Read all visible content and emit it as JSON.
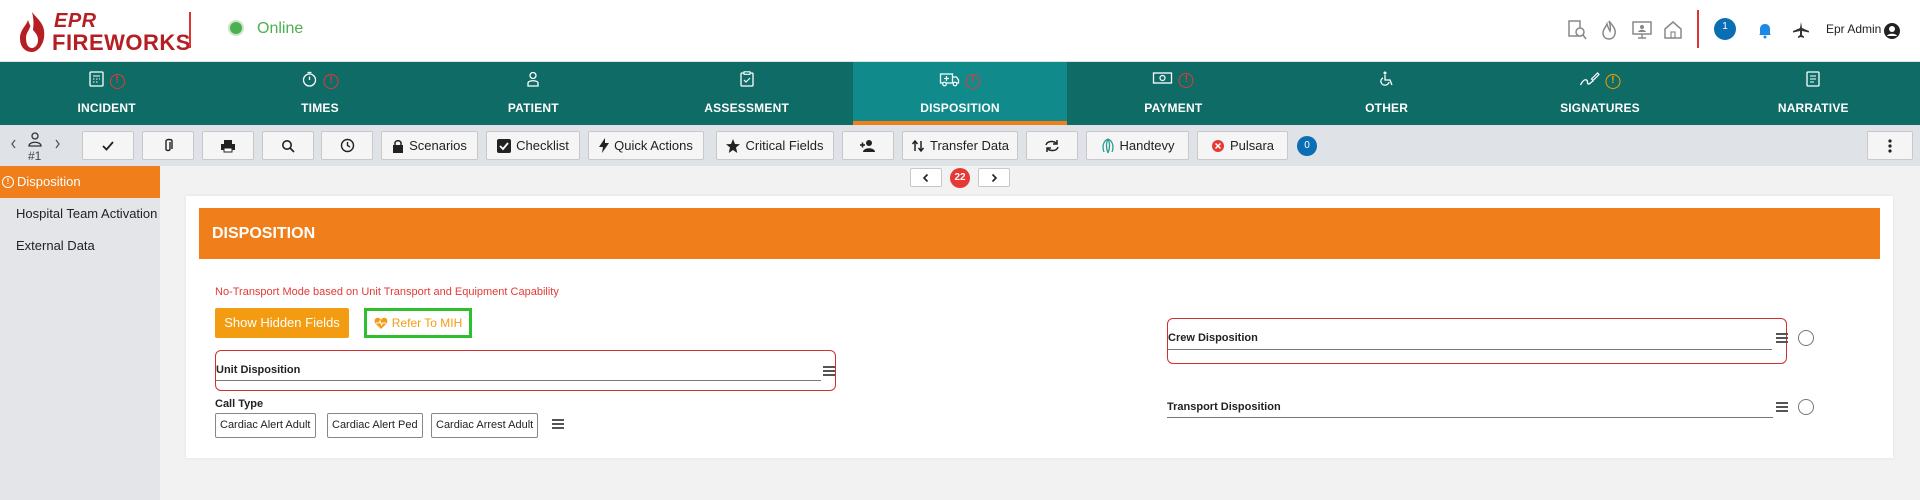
{
  "header": {
    "logo_top": "EPR",
    "logo_bottom": "FIREWORKS",
    "status": "Online",
    "chat_count": "1",
    "user_name": "Epr Admin"
  },
  "nav": {
    "tabs": [
      {
        "label": "INCIDENT",
        "icon": "calculator-icon",
        "warning": "red"
      },
      {
        "label": "TIMES",
        "icon": "stopwatch-icon",
        "warning": "red"
      },
      {
        "label": "PATIENT",
        "icon": "person-icon",
        "warning": ""
      },
      {
        "label": "ASSESSMENT",
        "icon": "clipboard-icon",
        "warning": ""
      },
      {
        "label": "DISPOSITION",
        "icon": "ambulance-icon",
        "warning": "red",
        "active": true
      },
      {
        "label": "PAYMENT",
        "icon": "money-icon",
        "warning": "red"
      },
      {
        "label": "OTHER",
        "icon": "wheelchair-icon",
        "warning": ""
      },
      {
        "label": "SIGNATURES",
        "icon": "signature-icon",
        "warning": "orange"
      },
      {
        "label": "NARRATIVE",
        "icon": "document-icon",
        "warning": ""
      }
    ]
  },
  "toolbar": {
    "patient_number": "#1",
    "scenarios": "Scenarios",
    "checklist": "Checklist",
    "quick_actions": "Quick Actions",
    "critical_fields": "Critical Fields",
    "transfer_data": "Transfer Data",
    "handtevy": "Handtevy",
    "pulsara": "Pulsara",
    "pulsara_count": "0"
  },
  "sidebar": {
    "items": [
      {
        "label": "Disposition",
        "active": true
      },
      {
        "label": "Hospital Team Activation"
      },
      {
        "label": "External Data"
      }
    ]
  },
  "pager": {
    "count": "22"
  },
  "disposition": {
    "title": "DISPOSITION",
    "warning": "No-Transport Mode based on Unit Transport and Equipment Capability",
    "show_hidden_label": "Show Hidden Fields",
    "refer_mih_label": "Refer To MIH",
    "unit_disposition_label": "Unit Disposition",
    "call_type_label": "Call Type",
    "call_types": [
      "Cardiac Alert Adult",
      "Cardiac Alert Ped",
      "Cardiac Arrest Adult"
    ],
    "crew_disposition_label": "Crew Disposition",
    "transport_disposition_label": "Transport Disposition"
  },
  "colors": {
    "brand_red": "#b51f24",
    "nav_teal": "#0e6b66",
    "accent_orange": "#f07e1a",
    "online_green": "#4caf50",
    "error_red": "#e53935"
  }
}
